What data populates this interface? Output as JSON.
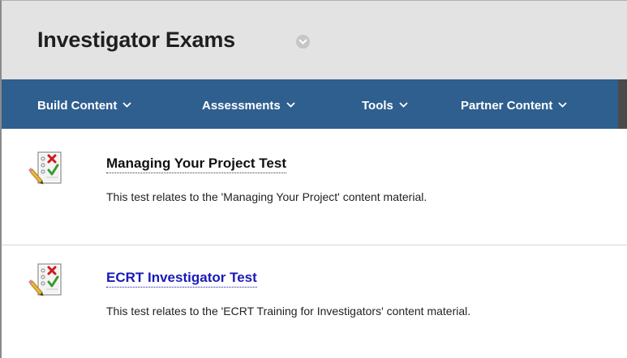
{
  "header": {
    "title": "Investigator Exams",
    "title_menu_icon": "chevron-down-circle-icon"
  },
  "nav": {
    "items": [
      {
        "label": "Build Content"
      },
      {
        "label": "Assessments"
      },
      {
        "label": "Tools"
      },
      {
        "label": "Partner Content"
      }
    ]
  },
  "content": {
    "items": [
      {
        "title": "Managing Your Project Test",
        "description": "This test relates to the 'Managing Your Project' content material.",
        "icon": "test-icon"
      },
      {
        "title": "ECRT Investigator Test",
        "description": "This test relates to the 'ECRT Training for Investigators' content material.",
        "icon": "test-icon"
      }
    ]
  },
  "colors": {
    "nav_bar": "#2f5f8f",
    "header_bg": "#e3e3e3",
    "link": "#1a1ab8"
  }
}
